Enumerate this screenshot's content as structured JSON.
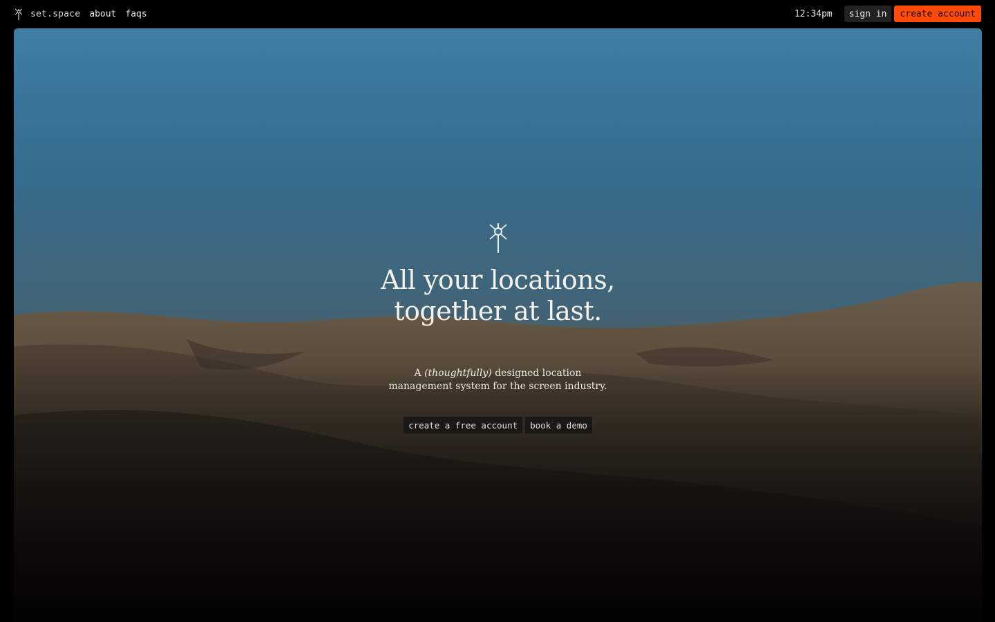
{
  "header": {
    "brand_name": "set.space",
    "logo_icon": "sparkle-star-icon",
    "nav": [
      {
        "label": "about"
      },
      {
        "label": "faqs"
      }
    ],
    "clock": "12:34pm",
    "sign_in_label": "sign in",
    "create_account_label": "create account"
  },
  "hero": {
    "mark_icon": "sparkle-star-icon",
    "headline_line1": "All your locations,",
    "headline_line2": "together at last.",
    "sub_prefix": "A ",
    "sub_emphasis": "(thoughtfully)",
    "sub_rest_line1": " designed location",
    "sub_line2": "management system for the screen industry.",
    "cta_primary": "create a free account",
    "cta_secondary": "book a demo",
    "background": "desert dunes at dusk"
  },
  "colors": {
    "accent": "#ff4a0a",
    "page_background": "#000000",
    "sky_top": "#3f7ea3",
    "sand": "#6a5a47"
  }
}
